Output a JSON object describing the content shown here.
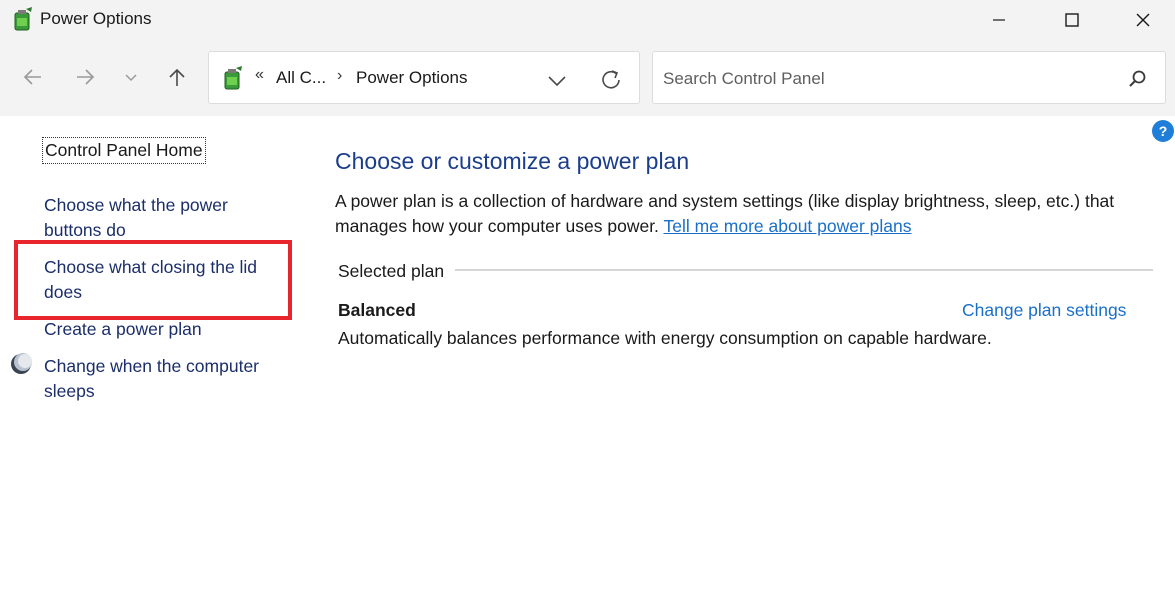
{
  "window": {
    "title": "Power Options",
    "minimize_icon": "minimize-icon",
    "maximize_icon": "maximize-icon",
    "close_icon": "close-icon"
  },
  "nav": {
    "back_icon": "arrow-left-icon",
    "forward_icon": "arrow-right-icon",
    "recent_icon": "chevron-down-icon",
    "up_icon": "arrow-up-icon"
  },
  "address": {
    "overflow": "«",
    "crumbs": [
      "All C...",
      "Power Options"
    ],
    "separator": "›"
  },
  "search": {
    "placeholder": "Search Control Panel"
  },
  "help": {
    "label": "?"
  },
  "sidebar": {
    "home": "Control Panel Home",
    "links": [
      "Choose what the power buttons do",
      "Choose what closing the lid does",
      "Create a power plan",
      "Change when the computer sleeps"
    ]
  },
  "main": {
    "title": "Choose or customize a power plan",
    "description": "A power plan is a collection of hardware and system settings (like display brightness, sleep, etc.) that manages how your computer uses power.",
    "description_link": "Tell me more about power plans",
    "selected_label": "Selected plan",
    "plan_name": "Balanced",
    "plan_link": "Change plan settings",
    "plan_description": "Automatically balances performance with energy consumption on capable hardware."
  },
  "colors": {
    "highlight": "#e8242c",
    "link": "#1a6fc9",
    "title": "#1b3e8c"
  }
}
